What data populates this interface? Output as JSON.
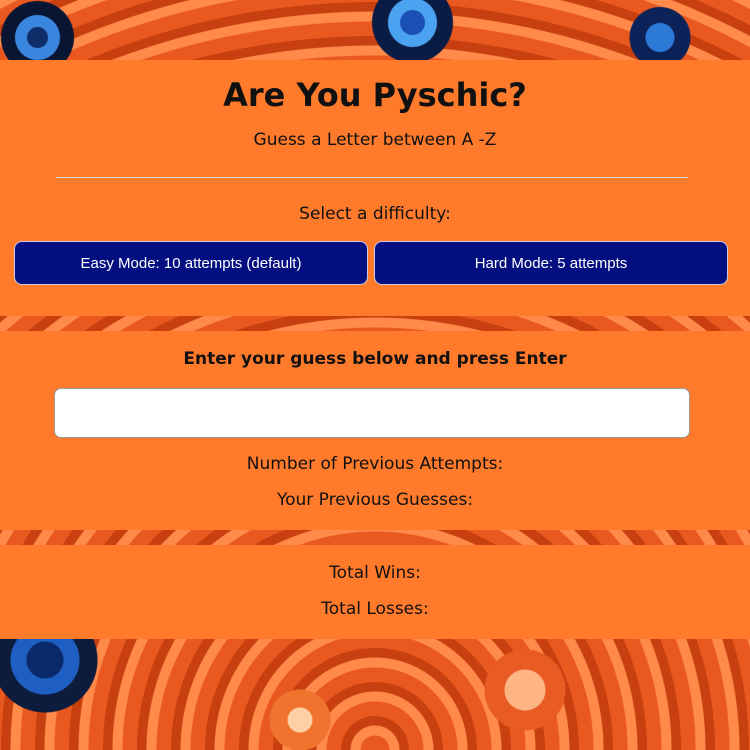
{
  "header": {
    "title": "Are You Pyschic?",
    "subtitle": "Guess a Letter between A -Z"
  },
  "difficulty": {
    "label": "Select a difficulty:",
    "easy_button": "Easy Mode: 10 attempts (default)",
    "hard_button": "Hard Mode: 5 attempts"
  },
  "guess": {
    "prompt": "Enter your guess below and press Enter",
    "input_value": "",
    "attempts_label": "Number of Previous Attempts:",
    "previous_guesses_label": "Your Previous Guesses:"
  },
  "totals": {
    "wins_label": "Total Wins:",
    "losses_label": "Total Losses:"
  },
  "colors": {
    "panel": "#ff7a2a",
    "button": "#030f80"
  }
}
